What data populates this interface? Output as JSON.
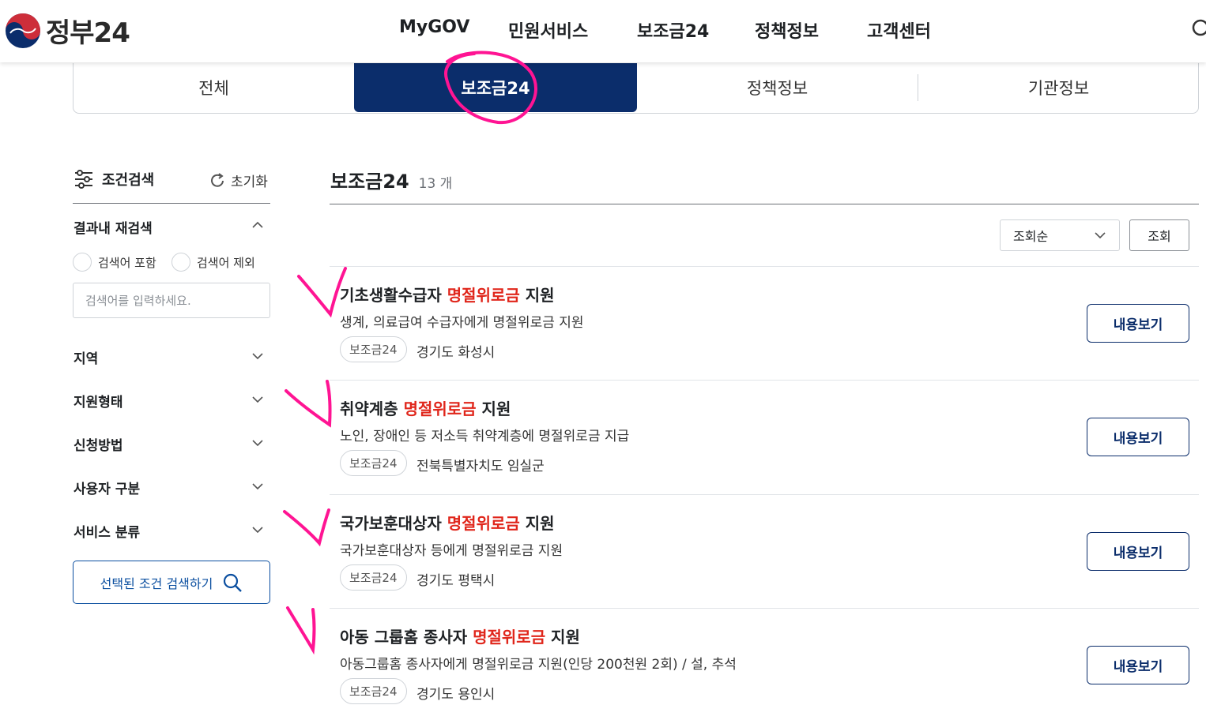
{
  "header": {
    "logo_text": "정부24",
    "nav": [
      "MyGOV",
      "민원서비스",
      "보조금24",
      "정책정보",
      "고객센터"
    ]
  },
  "tabs": [
    {
      "label": "전체",
      "active": false
    },
    {
      "label": "보조금24",
      "active": true
    },
    {
      "label": "정책정보",
      "active": false
    },
    {
      "label": "기관정보",
      "active": false
    }
  ],
  "sidebar": {
    "title": "조건검색",
    "reset": "초기화",
    "research_title": "결과내 재검색",
    "radio_include": "검색어 포함",
    "radio_exclude": "검색어 제외",
    "search_placeholder": "검색어를 입력하세요.",
    "filters": [
      "지역",
      "지원형태",
      "신청방법",
      "사용자 구분",
      "서비스 분류"
    ],
    "search_button": "선택된 조건 검색하기"
  },
  "main": {
    "title": "보조금24",
    "count": "13 개",
    "sort_selected": "조회순",
    "view_button": "조회",
    "items": [
      {
        "title_pre": "기초생활수급자 ",
        "title_hl": "명절위로금",
        "title_post": " 지원",
        "desc": "생계, 의료급여 수급자에게 명절위로금 지원",
        "tag": "보조금24",
        "region": "경기도 화성시",
        "button": "내용보기"
      },
      {
        "title_pre": "취약계층 ",
        "title_hl": "명절위로금",
        "title_post": " 지원",
        "desc": "노인, 장애인 등 저소득 취약계층에 명절위로금 지급",
        "tag": "보조금24",
        "region": "전북특별자치도 임실군",
        "button": "내용보기"
      },
      {
        "title_pre": "국가보훈대상자 ",
        "title_hl": "명절위로금",
        "title_post": " 지원",
        "desc": "국가보훈대상자 등에게 명절위로금 지원",
        "tag": "보조금24",
        "region": "경기도 평택시",
        "button": "내용보기"
      },
      {
        "title_pre": "아동 그룹홈 종사자 ",
        "title_hl": "명절위로금",
        "title_post": " 지원",
        "desc": "아동그룹홈 종사자에게 명절위로금 지원(인당 200천원 2회) / 설, 추석",
        "tag": "보조금24",
        "region": "경기도 용인시",
        "button": "내용보기"
      }
    ]
  },
  "colors": {
    "primary": "#0b2d6b",
    "highlight": "#e0261b",
    "annotation": "#ff1493"
  }
}
